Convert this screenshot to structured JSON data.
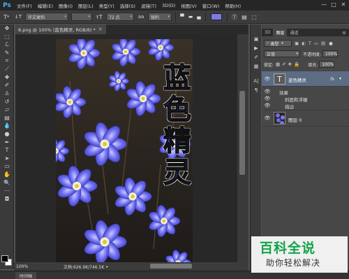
{
  "app": {
    "logo": "Ps"
  },
  "menu": [
    "文件(F)",
    "编辑(E)",
    "图像(I)",
    "图层(L)",
    "类型(Y)",
    "选择(S)",
    "滤镜(T)",
    "3D(D)",
    "视图(V)",
    "窗口(W)",
    "帮助(H)"
  ],
  "window_controls": {
    "minimize": "—",
    "maximize": "□",
    "close": "✕"
  },
  "options": {
    "font_family": "华文琥珀",
    "font_size": "72 点",
    "antialias": "锐利",
    "text_color": "#7c79e6",
    "orientation_icon": "text-orientation-icon"
  },
  "document": {
    "tab_title": "8.png @ 100% (蓝色精灵, RGB/8) *",
    "close": "✕"
  },
  "canvas_text": [
    "蓝",
    "色",
    "精",
    "灵"
  ],
  "status": {
    "zoom": "100%",
    "doc_info": "文档:626.9K/746.5K"
  },
  "timeline": {
    "tab": "时间轴"
  },
  "layers_panel": {
    "tabs": [
      "3D",
      "图层",
      "通道"
    ],
    "filter_kind": "类型",
    "blend_mode": "正常",
    "opacity_label": "不透明度:",
    "opacity_value": "100%",
    "lock_label": "锁定:",
    "fill_label": "填充:",
    "fill_value": "100%",
    "layers": [
      {
        "name": "蓝色精灵",
        "fx": "fx",
        "effects_label": "效果",
        "effects": [
          "斜面和浮雕",
          "描边"
        ]
      },
      {
        "name": "图层 0"
      }
    ]
  },
  "watermark": {
    "title": "百科全说",
    "subtitle": "助你轻松解决"
  }
}
